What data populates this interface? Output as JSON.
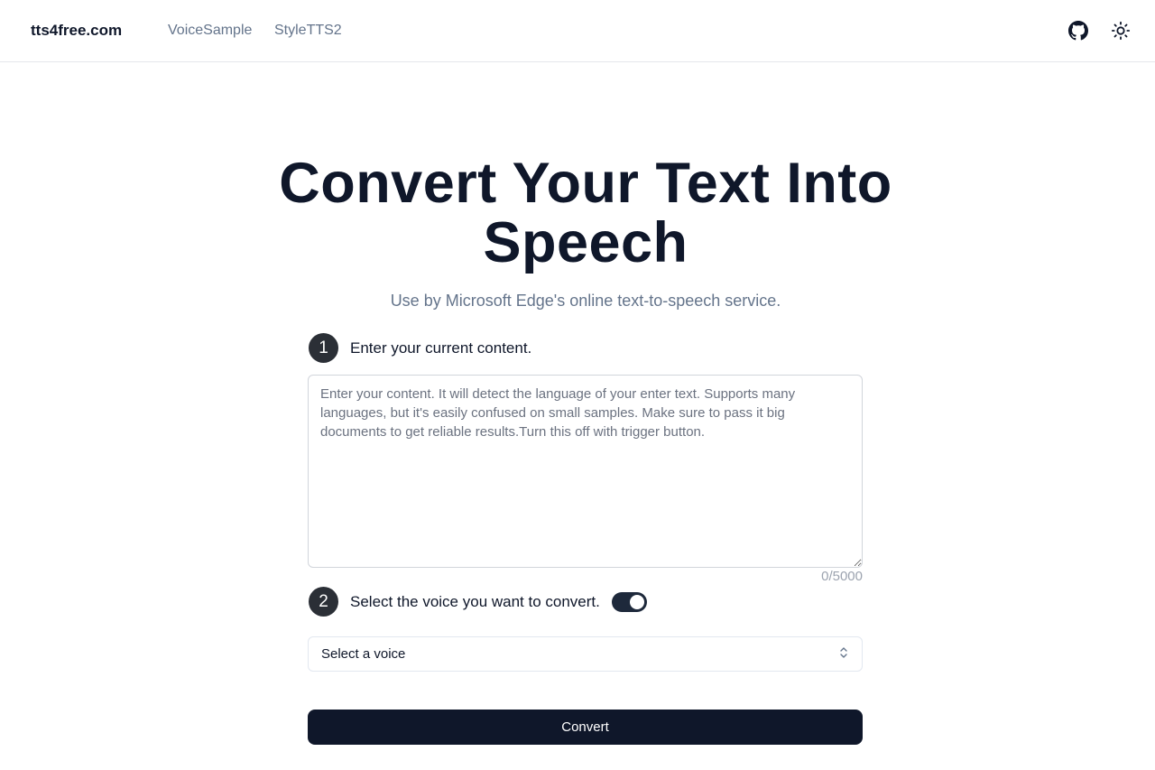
{
  "nav": {
    "brand": "tts4free.com",
    "links": [
      "VoiceSample",
      "StyleTTS2"
    ],
    "icons": [
      "github-icon",
      "sun-icon"
    ]
  },
  "hero": {
    "title": "Convert Your Text Into Speech",
    "subtitle": "Use by Microsoft Edge's online text-to-speech service."
  },
  "step1": {
    "number": "1",
    "label": "Enter your current content.",
    "placeholder": "Enter your content. It will detect the language of your enter text. Supports many languages, but it's easily confused on small samples. Make sure to pass it big documents to get reliable results.Turn this off with trigger button.",
    "value": "",
    "counter": "0/5000"
  },
  "step2": {
    "number": "2",
    "label": "Select the voice you want to convert.",
    "toggle_on": true,
    "select_value": "Select a voice"
  },
  "actions": {
    "convert_label": "Convert"
  },
  "colors": {
    "primary": "#0f172a",
    "muted": "#64748b",
    "step_badge": "#2b2f36",
    "border": "#d1d5db"
  }
}
